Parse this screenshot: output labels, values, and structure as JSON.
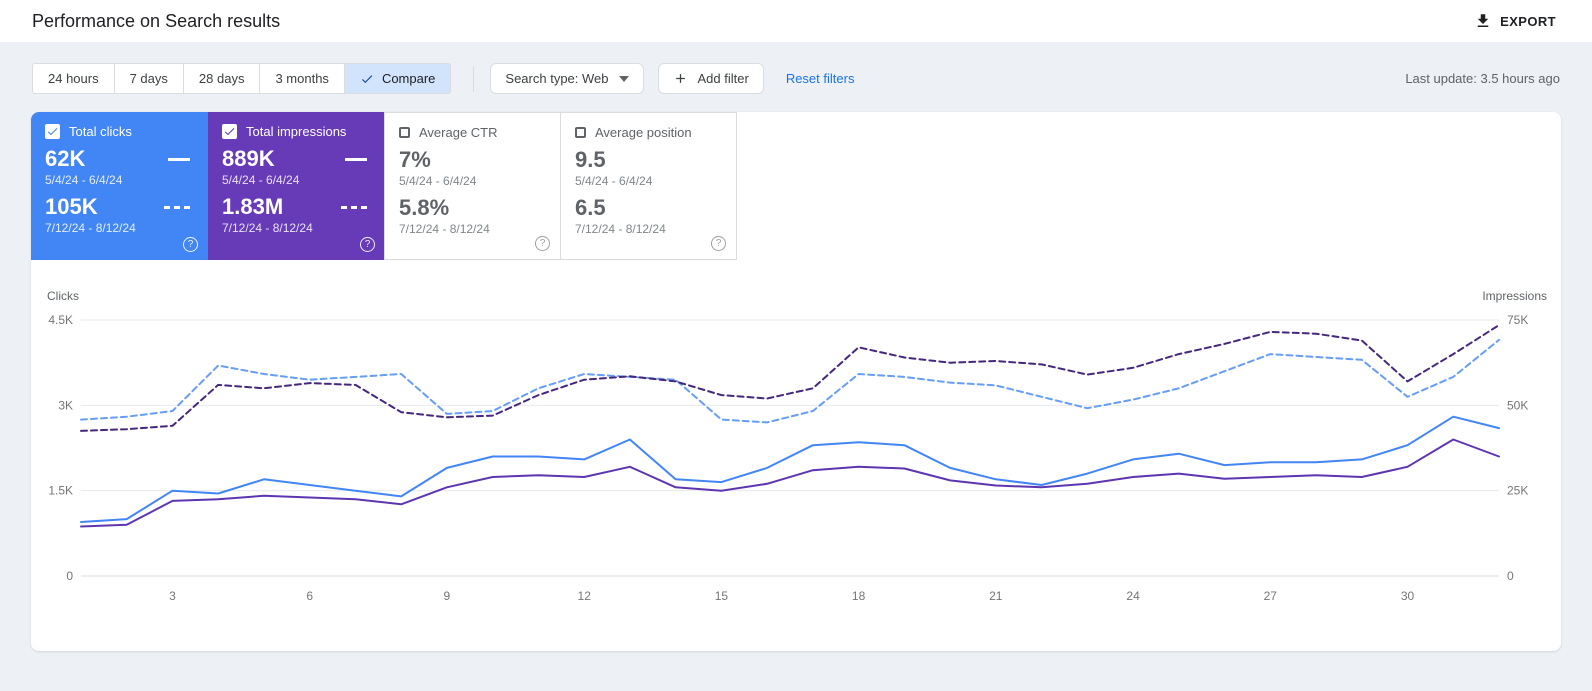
{
  "header": {
    "title": "Performance on Search results",
    "export_label": "EXPORT"
  },
  "filterbar": {
    "date_ranges": [
      "24 hours",
      "7 days",
      "28 days",
      "3 months"
    ],
    "compare_label": "Compare",
    "search_type": "Search type: Web",
    "add_filter": "Add filter",
    "reset_filters": "Reset filters",
    "last_update": "Last update: 3.5 hours ago"
  },
  "icons": {
    "export": "download-icon",
    "compare": "check-icon",
    "search_type": "chevron-down-icon",
    "add_filter": "plus-icon",
    "metric_help": "question-circle-icon"
  },
  "colors": {
    "clicks_card": "#4285f4",
    "impressions_card": "#673ab7",
    "compare_selected_bg": "#d2e3fc",
    "link_blue": "#1a73e8"
  },
  "metrics": [
    {
      "label": "Total clicks",
      "checked": true,
      "value1": "62K",
      "range1": "5/4/24 - 6/4/24",
      "value2": "105K",
      "range2": "7/12/24 - 8/12/24"
    },
    {
      "label": "Total impressions",
      "checked": true,
      "value1": "889K",
      "range1": "5/4/24 - 6/4/24",
      "value2": "1.83M",
      "range2": "7/12/24 - 8/12/24"
    },
    {
      "label": "Average CTR",
      "checked": false,
      "value1": "7%",
      "range1": "5/4/24 - 6/4/24",
      "value2": "5.8%",
      "range2": "7/12/24 - 8/12/24"
    },
    {
      "label": "Average position",
      "checked": false,
      "value1": "9.5",
      "range1": "5/4/24 - 6/4/24",
      "value2": "6.5",
      "range2": "7/12/24 - 8/12/24"
    }
  ],
  "chart_data": {
    "type": "line",
    "x": [
      1,
      2,
      3,
      4,
      5,
      6,
      7,
      8,
      9,
      10,
      11,
      12,
      13,
      14,
      15,
      16,
      17,
      18,
      19,
      20,
      21,
      22,
      23,
      24,
      25,
      26,
      27,
      28,
      29,
      30,
      31,
      32
    ],
    "x_ticks": [
      3,
      6,
      9,
      12,
      15,
      18,
      21,
      24,
      27,
      30
    ],
    "grid": true,
    "left_axis": {
      "label": "Clicks",
      "max": 4500,
      "ticks": [
        0,
        1500,
        3000,
        4500
      ],
      "tick_labels": [
        "0",
        "1.5K",
        "3K",
        "4.5K"
      ]
    },
    "right_axis": {
      "label": "Impressions",
      "max": 75000,
      "ticks": [
        0,
        25000,
        50000,
        75000
      ],
      "tick_labels": [
        "0",
        "25K",
        "50K",
        "75K"
      ]
    },
    "series": [
      {
        "name": "Total clicks 5/4/24 - 6/4/24",
        "axis": "left",
        "style": "solid",
        "color": "#4285f4",
        "values": [
          950,
          1000,
          1500,
          1450,
          1700,
          1600,
          1500,
          1400,
          1900,
          2100,
          2100,
          2050,
          2400,
          1700,
          1650,
          1900,
          2300,
          2350,
          2300,
          1900,
          1700,
          1600,
          1800,
          2050,
          2150,
          1950,
          2000,
          2000,
          2050,
          2300,
          2800,
          2600
        ]
      },
      {
        "name": "Total clicks 7/12/24 - 8/12/24",
        "axis": "left",
        "style": "dashed",
        "color": "#669df6",
        "values": [
          2750,
          2800,
          2900,
          3700,
          3550,
          3450,
          3500,
          3550,
          2850,
          2900,
          3300,
          3550,
          3500,
          3450,
          2750,
          2700,
          2900,
          3550,
          3500,
          3400,
          3350,
          3150,
          2950,
          3100,
          3300,
          3600,
          3900,
          3850,
          3800,
          3150,
          3500,
          4150
        ]
      },
      {
        "name": "Total impressions 5/4/24 - 6/4/24",
        "axis": "right",
        "style": "solid",
        "color": "#5e35b1",
        "values": [
          14500,
          15000,
          22000,
          22500,
          23500,
          23000,
          22500,
          21000,
          26000,
          29000,
          29500,
          29000,
          32000,
          26000,
          25000,
          27000,
          31000,
          32000,
          31500,
          28000,
          26500,
          26000,
          27000,
          29000,
          30000,
          28500,
          29000,
          29500,
          29000,
          32000,
          40000,
          35000
        ]
      },
      {
        "name": "Total impressions 7/12/24 - 8/12/24",
        "axis": "right",
        "style": "dashed",
        "color": "#45277e",
        "values": [
          42500,
          43000,
          44000,
          56000,
          55000,
          56500,
          56000,
          48000,
          46500,
          47000,
          53000,
          57500,
          58500,
          57000,
          53000,
          52000,
          55000,
          67000,
          64000,
          62500,
          63000,
          62000,
          59000,
          61000,
          65000,
          68000,
          71500,
          71000,
          69000,
          57000,
          65000,
          73500
        ]
      }
    ]
  }
}
